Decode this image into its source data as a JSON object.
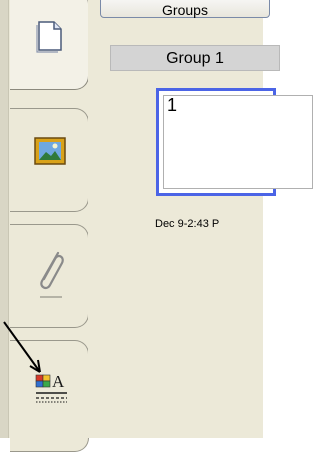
{
  "window": {
    "top_caption": "Groups"
  },
  "side_tabs": [
    {
      "name": "page-sorter",
      "icon": "page-icon"
    },
    {
      "name": "gallery",
      "icon": "picture-icon"
    },
    {
      "name": "attachments",
      "icon": "paperclip-icon"
    },
    {
      "name": "properties",
      "icon": "properties-icon"
    }
  ],
  "panel": {
    "groups_button_label": "Groups",
    "group_header": "Group 1",
    "page_number": "1",
    "page_caption": "Dec 9-2:43 P"
  },
  "colors": {
    "selection_border": "#4b64e6",
    "tab_background": "#ece9d8"
  }
}
